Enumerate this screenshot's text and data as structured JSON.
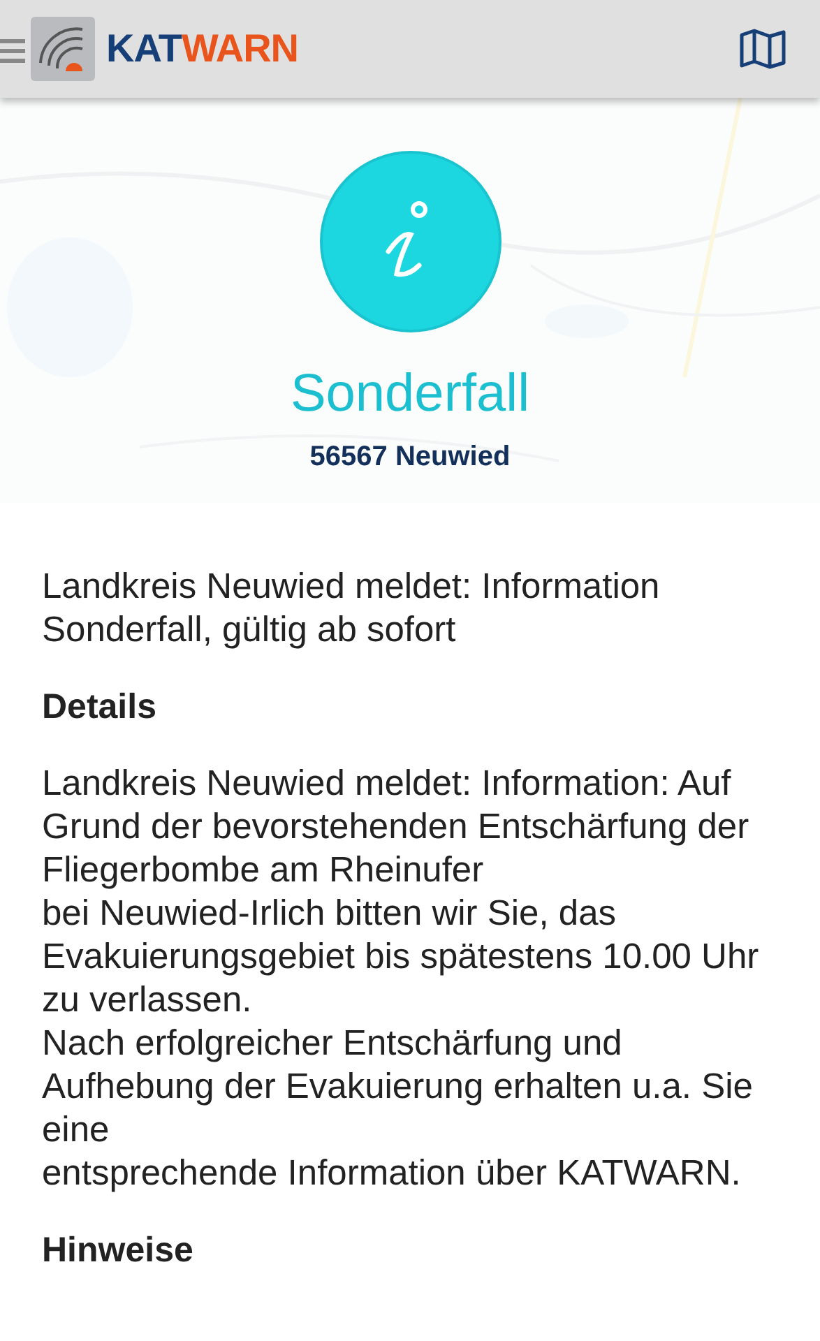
{
  "app_bar": {
    "logo_text": {
      "part_1": "KAT",
      "part_2": "WARN"
    }
  },
  "alert": {
    "kind": "info",
    "title": "Sonderfall",
    "location": "56567 Neuwied"
  },
  "summary": "Landkreis Neuwied meldet: Information Sonderfall, gültig ab sofort",
  "sections": [
    {
      "heading": "Details",
      "lines": [
        "Landkreis Neuwied meldet: Information: Auf Grund der bevorstehenden Entschärfung der Fliegerbombe am Rheinufer",
        "bei Neuwied-Irlich bitten wir Sie, das Evakuierungsgebiet bis spätestens 10.00 Uhr zu verlassen.",
        "Nach erfolgreicher Entschärfung und Aufhebung der Evakuierung erhalten u.a. Sie eine",
        "entsprechende Information über KATWARN."
      ]
    },
    {
      "heading": "Hinweise"
    }
  ]
}
